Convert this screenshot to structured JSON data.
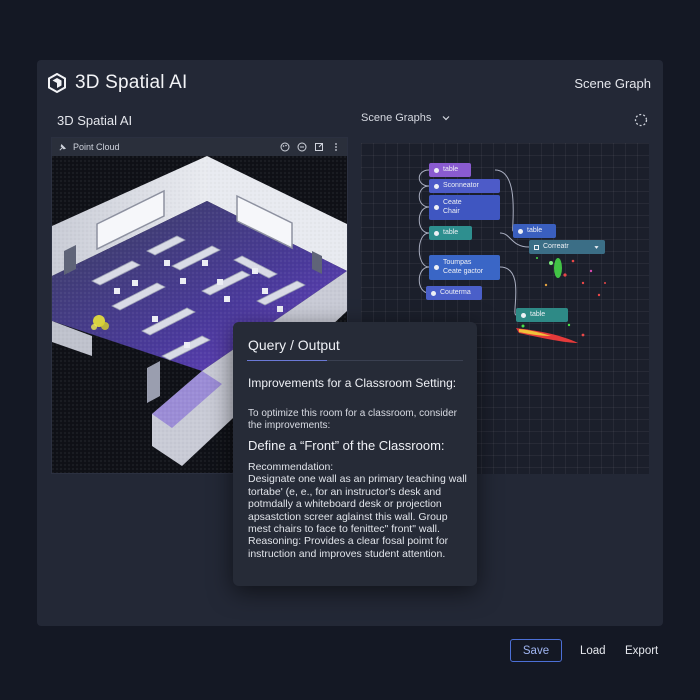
{
  "app": {
    "brand_title": "3D Spatial AI",
    "header_right": "Scene Graph",
    "subbar_title": "3D Spatial AI",
    "scene_graph_select": "Scene Graphs",
    "accent_color": "#4c6fd6"
  },
  "point_cloud": {
    "title": "Point Cloud",
    "tools": [
      "palette-icon",
      "minus-circle-icon",
      "expand-icon",
      "more-vertical-icon"
    ]
  },
  "scene_graph": {
    "nodes": [
      {
        "label": "table",
        "color": "#8a5bd0"
      },
      {
        "label": "Sconneator",
        "color": "#4d5bc8"
      },
      {
        "label": "Ceate\nChair",
        "color": "#3f56c1"
      },
      {
        "label": "table",
        "color": "#2e8f8f"
      },
      {
        "label": "Toumpas\nCeate gactor",
        "color": "#3a66c6"
      },
      {
        "label": "Couterma",
        "color": "#4a5fc9"
      },
      {
        "label": "table",
        "color": "#3a5fbf"
      },
      {
        "label": "Correatr",
        "color": "#3b6e86"
      },
      {
        "label": "table",
        "color": "#2e8a86"
      }
    ]
  },
  "query": {
    "title": "Query / Output",
    "heading": "Improvements for a Classroom Setting:",
    "intro": "To optimize this room for a classroom, consider the improvements:",
    "subheading": "Define a “Front” of the Classroom:",
    "recommendation_label": "Recommendation:",
    "recommendation": "Designate one wall as an primary teaching wall tortabe' (e, e., for an instructor's desk and potmdally a whiteboard desk or projection apsastction screer aglainst this wall. Group mest chairs to face to fenittec\" front\" wall.",
    "reasoning": "Reasoning: Provides a clear fosal poimt for instruction and improves student attention."
  },
  "footer": {
    "save": "Save",
    "load": "Load",
    "export": "Export"
  }
}
